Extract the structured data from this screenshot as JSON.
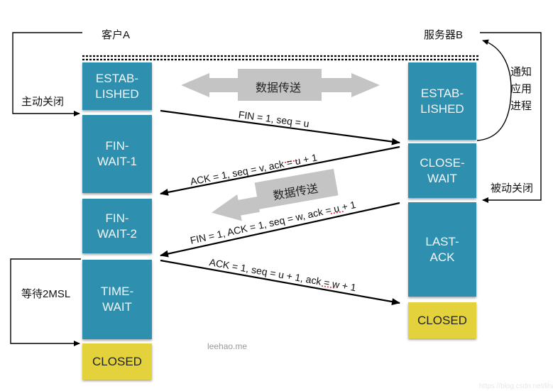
{
  "client": {
    "title": "客户A",
    "states": [
      {
        "label": "ESTAB-\nLISHED",
        "kind": "active"
      },
      {
        "label": "FIN-\nWAIT-1",
        "kind": "active"
      },
      {
        "label": "FIN-\nWAIT-2",
        "kind": "active"
      },
      {
        "label": "TIME-\nWAIT",
        "kind": "active"
      },
      {
        "label": "CLOSED",
        "kind": "closed"
      }
    ],
    "active_close_label": "主动关闭",
    "wait_label": "等待2MSL"
  },
  "server": {
    "title": "服务器B",
    "states": [
      {
        "label": "ESTAB-\nLISHED",
        "kind": "active"
      },
      {
        "label": "CLOSE-\nWAIT",
        "kind": "active"
      },
      {
        "label": "LAST-\nACK",
        "kind": "active"
      },
      {
        "label": "CLOSED",
        "kind": "closed"
      }
    ],
    "notify_label": "通知\n应用\n进程",
    "passive_close_label": "被动关闭"
  },
  "data_transfer": {
    "bidirectional_label": "数据传送",
    "server_to_client_label": "数据传送"
  },
  "messages": [
    {
      "text": "FIN = 1, seq = u",
      "direction": "client-to-server"
    },
    {
      "text": "ACK = 1, seq = v, ack = u + 1",
      "direction": "server-to-client"
    },
    {
      "text": "FIN = 1, ACK = 1, seq = w, ack = u + 1",
      "direction": "server-to-client"
    },
    {
      "text": "ACK = 1, seq = u + 1, ack = w  + 1",
      "direction": "client-to-server"
    }
  ],
  "colors": {
    "active_state": "#2f8fae",
    "closed_state": "#e3d23c",
    "data_arrow": "#c4c4c4"
  },
  "watermark": "leehao.me",
  "source_watermark": "https://blog.csdn.net/liha"
}
